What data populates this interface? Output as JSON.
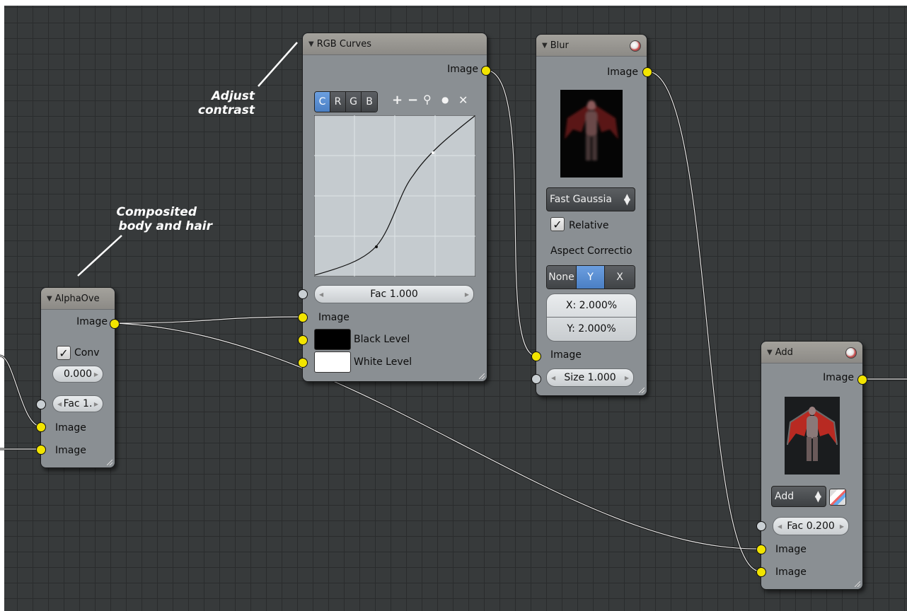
{
  "annotations": {
    "adjust_contrast": [
      "Adjust",
      "contrast"
    ],
    "composited": [
      "Composited",
      "body and hair"
    ]
  },
  "alpha_over": {
    "title": "AlphaOve",
    "output_image": "Image",
    "convert_label": "Conv",
    "value": "0.000",
    "fac": "Fac 1.",
    "input_image_1": "Image",
    "input_image_2": "Image"
  },
  "rgb_curves": {
    "title": "RGB Curves",
    "output_image": "Image",
    "channels": [
      "C",
      "R",
      "G",
      "B"
    ],
    "active_channel": "C",
    "tool_icons": [
      "zoom-in-icon",
      "zoom-out-icon",
      "wrench-icon",
      "point-icon",
      "close-icon"
    ],
    "tool_glyphs": [
      "+",
      "−",
      "⚲",
      "●",
      "✕"
    ],
    "fac": "Fac 1.000",
    "input_image": "Image",
    "black_level": "Black Level",
    "white_level": "White Level",
    "black_color": "#000000",
    "white_color": "#ffffff"
  },
  "blur": {
    "title": "Blur",
    "output_image": "Image",
    "filter_type": "Fast Gaussia",
    "relative_label": "Relative",
    "aspect_label": "Aspect Correctio",
    "aspect_options": [
      "None",
      "Y",
      "X"
    ],
    "aspect_selected": "Y",
    "x_value": "X: 2.000%",
    "y_value": "Y: 2.000%",
    "input_image": "Image",
    "size": "Size 1.000"
  },
  "add": {
    "title": "Add",
    "output_image": "Image",
    "blend_mode": "Add",
    "fac": "Fac 0.200",
    "input_image_1": "Image",
    "input_image_2": "Image"
  },
  "colors": {
    "socket_image": "#f2e400",
    "socket_value": "#c9cfd3",
    "grid_bg": "#373a3b",
    "accent_blue": "#5a8fd6"
  }
}
